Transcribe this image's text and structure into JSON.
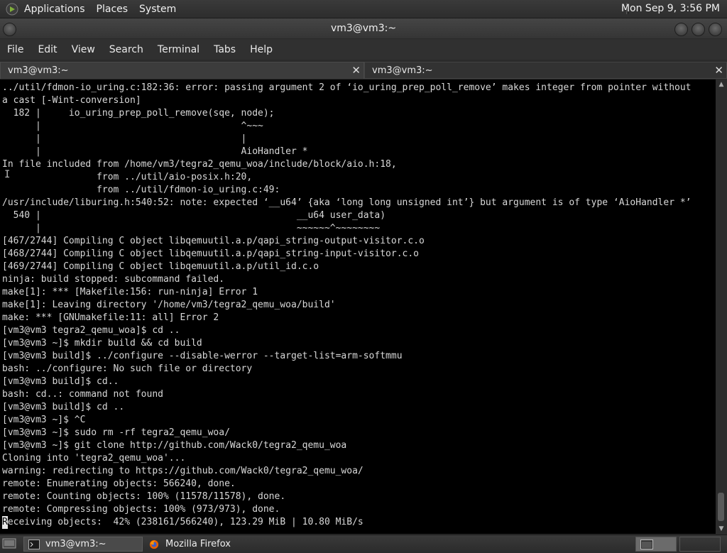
{
  "top_panel": {
    "menus": [
      "Applications",
      "Places",
      "System"
    ],
    "clock": "Mon Sep  9,  3:56 PM"
  },
  "window": {
    "title": "vm3@vm3:~"
  },
  "menubar": {
    "items": [
      "File",
      "Edit",
      "View",
      "Search",
      "Terminal",
      "Tabs",
      "Help"
    ]
  },
  "tabs": [
    {
      "label": "vm3@vm3:~",
      "active": true
    },
    {
      "label": "vm3@vm3:~",
      "active": false
    }
  ],
  "terminal": {
    "lines": [
      "../util/fdmon-io_uring.c:182:36: error: passing argument 2 of ‘io_uring_prep_poll_remove’ makes integer from pointer without",
      "a cast [-Wint-conversion]",
      "  182 |     io_uring_prep_poll_remove(sqe, node);",
      "      |                                    ^~~~",
      "      |                                    |",
      "      |                                    AioHandler *",
      "In file included from /home/vm3/tegra2_qemu_woa/include/block/aio.h:18,",
      "                 from ../util/aio-posix.h:20,",
      "                 from ../util/fdmon-io_uring.c:49:",
      "/usr/include/liburing.h:540:52: note: expected ‘__u64’ {aka ‘long long unsigned int’} but argument is of type ‘AioHandler *’",
      "  540 |                                              __u64 user_data)",
      "      |                                              ~~~~~~^~~~~~~~~",
      "[467/2744] Compiling C object libqemuutil.a.p/qapi_string-output-visitor.c.o",
      "[468/2744] Compiling C object libqemuutil.a.p/qapi_string-input-visitor.c.o",
      "[469/2744] Compiling C object libqemuutil.a.p/util_id.c.o",
      "ninja: build stopped: subcommand failed.",
      "make[1]: *** [Makefile:156: run-ninja] Error 1",
      "make[1]: Leaving directory '/home/vm3/tegra2_qemu_woa/build'",
      "make: *** [GNUmakefile:11: all] Error 2",
      "[vm3@vm3 tegra2_qemu_woa]$ cd ..",
      "[vm3@vm3 ~]$ mkdir build && cd build",
      "[vm3@vm3 build]$ ../configure --disable-werror --target-list=arm-softmmu",
      "bash: ../configure: No such file or directory",
      "[vm3@vm3 build]$ cd..",
      "bash: cd..: command not found",
      "[vm3@vm3 build]$ cd ..",
      "[vm3@vm3 ~]$ ^C",
      "[vm3@vm3 ~]$ sudo rm -rf tegra2_qemu_woa/",
      "[vm3@vm3 ~]$ git clone http://github.com/Wack0/tegra2_qemu_woa",
      "Cloning into 'tegra2_qemu_woa'...",
      "warning: redirecting to https://github.com/Wack0/tegra2_qemu_woa/",
      "remote: Enumerating objects: 566240, done.",
      "remote: Counting objects: 100% (11578/11578), done.",
      "remote: Compressing objects: 100% (973/973), done."
    ],
    "cursor_char": "R",
    "last_line_rest": "eceiving objects:  42% (238161/566240), 123.29 MiB | 10.80 MiB/s"
  },
  "taskbar": {
    "tasks": [
      {
        "label": "vm3@vm3:~",
        "active": true,
        "icon": "terminal-icon"
      },
      {
        "label": "Mozilla Firefox",
        "active": false,
        "icon": "firefox-icon"
      }
    ]
  },
  "colors": {
    "terminal_bg": "#000000",
    "terminal_fg": "#d8d8d8",
    "panel_bg": "#2d2d2d"
  }
}
